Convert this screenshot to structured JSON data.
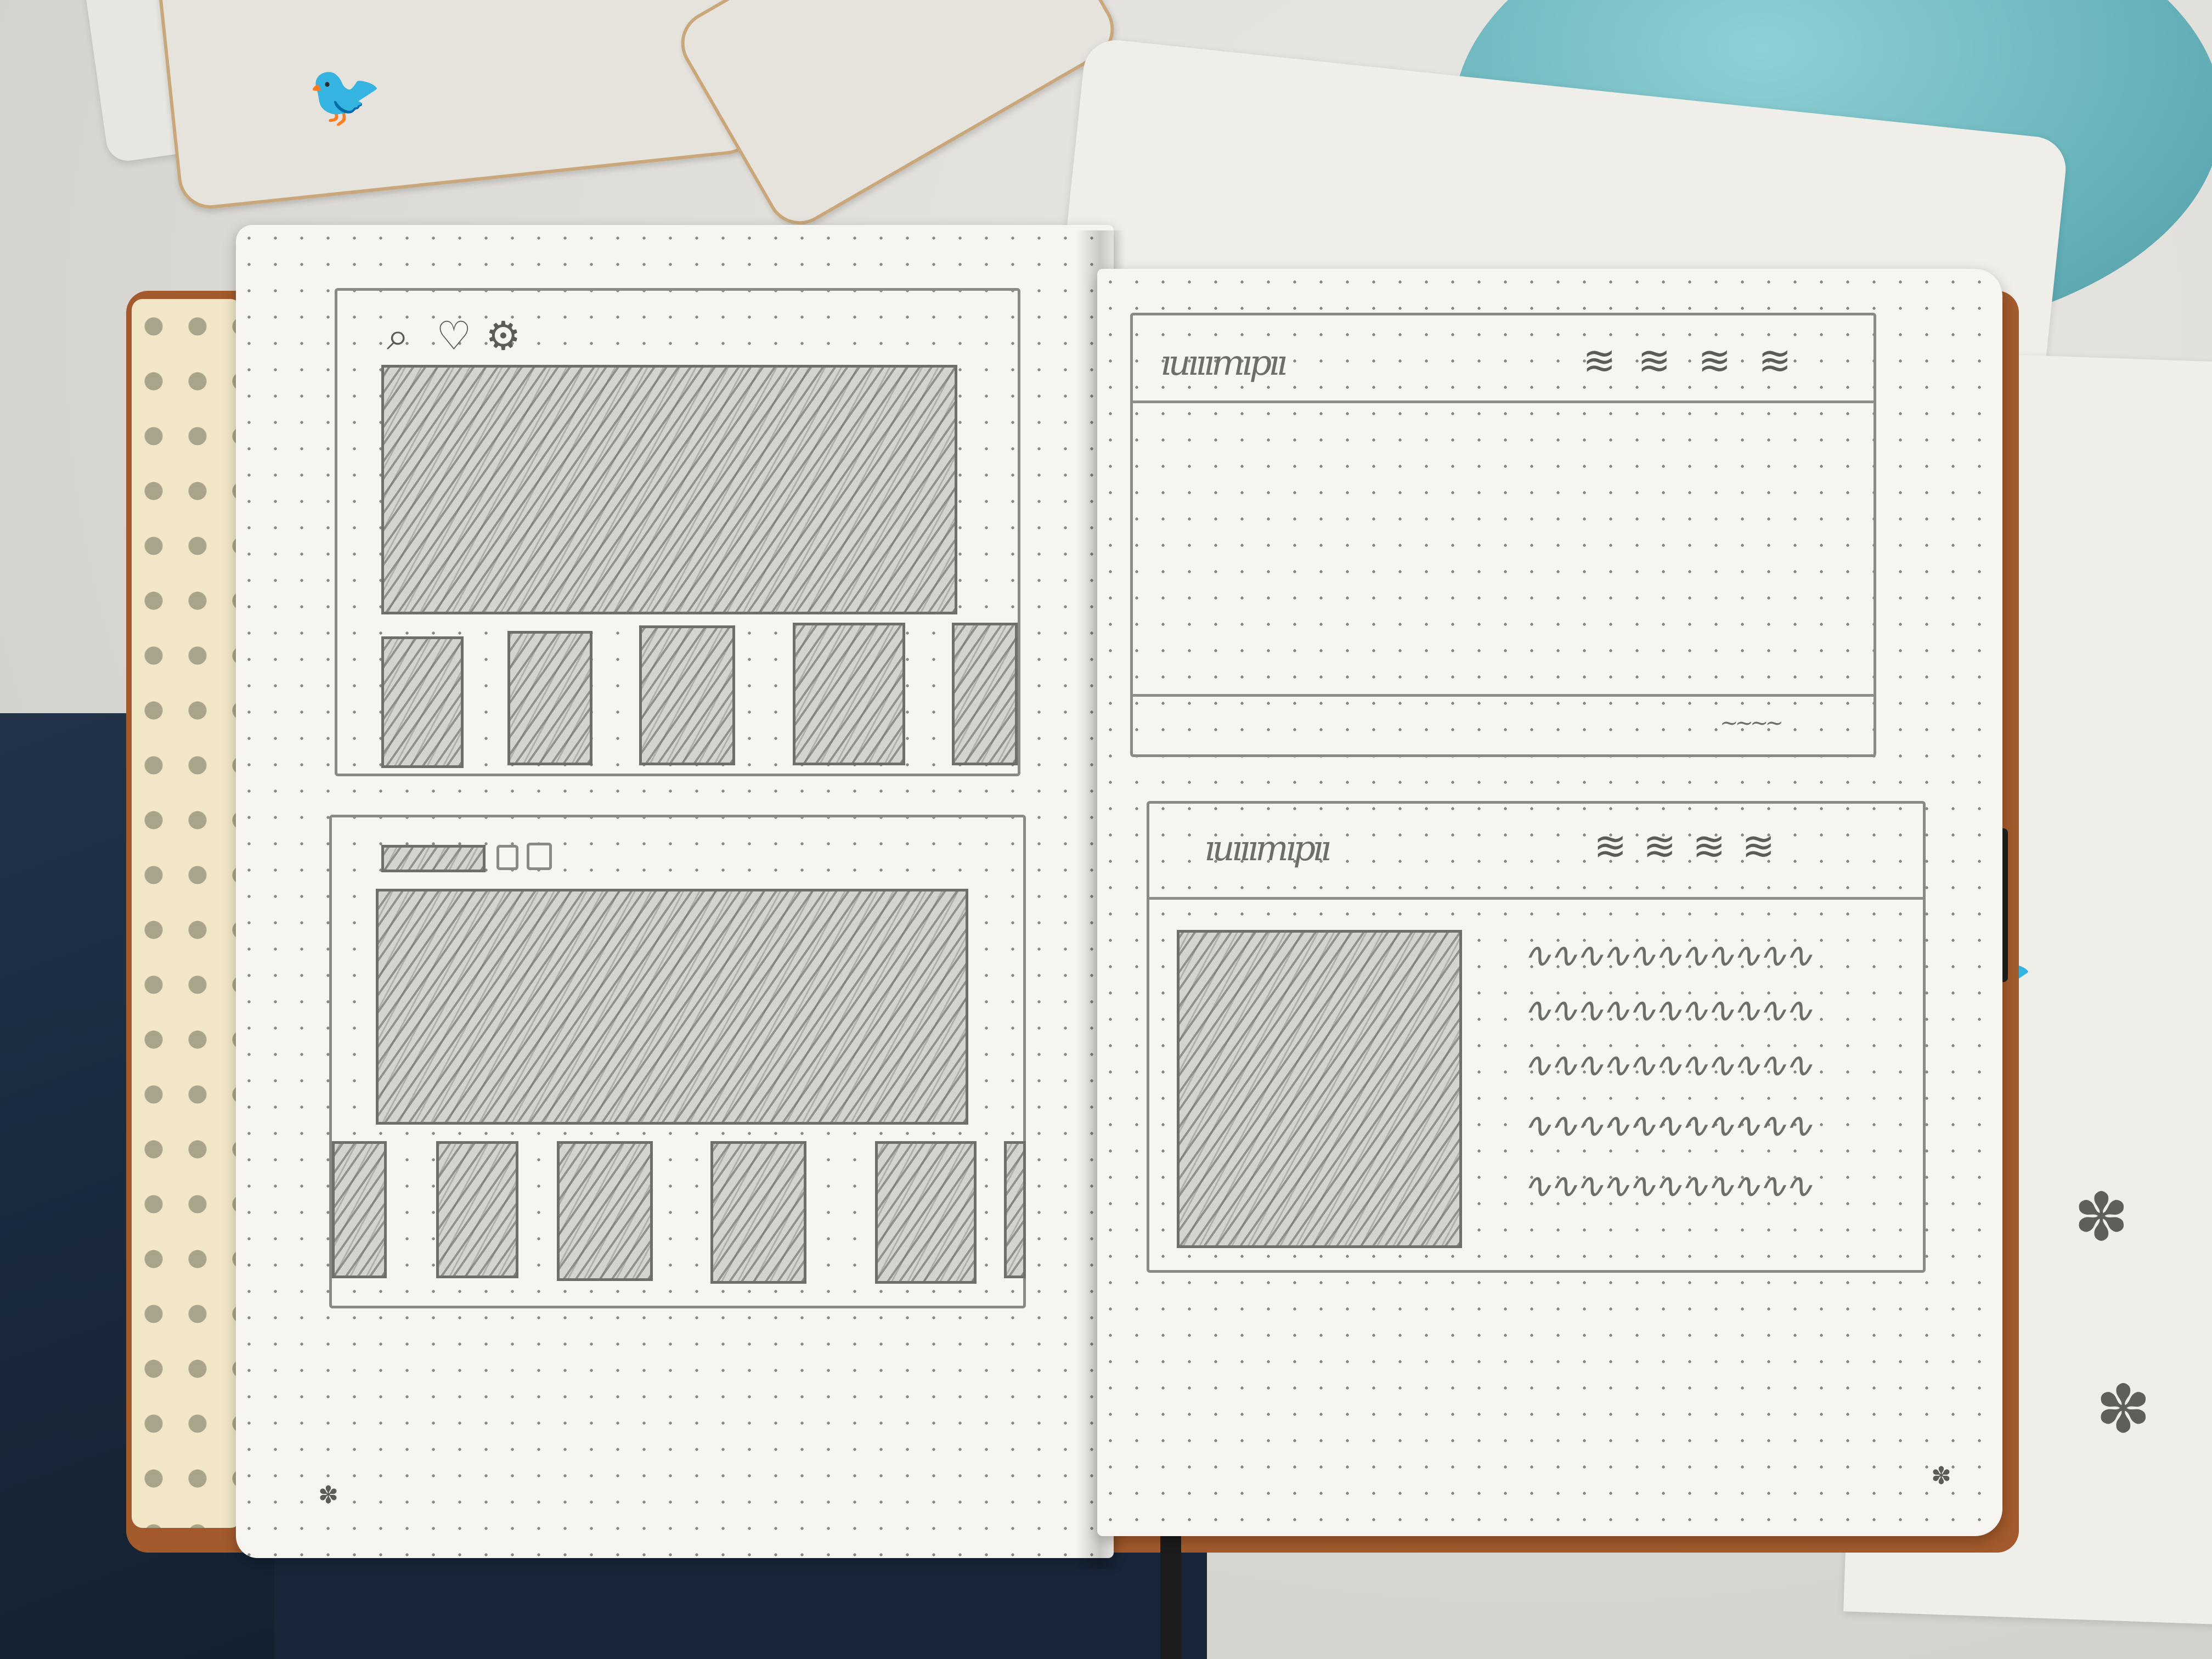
{
  "scene": {
    "description_free": true,
    "colors": {
      "page": "#f6f5f1",
      "pencil": "#6f6e6b",
      "cover": "#a35a2c",
      "jeans": "#1a2a3d",
      "teal_cup": "#67b2bb"
    }
  },
  "left_page": {
    "wireframe_top": {
      "icons": [
        "search-icon",
        "heart-icon",
        "gear-icon"
      ],
      "thumbnail_count": 5
    },
    "wireframe_bottom": {
      "thumbnail_count": 6
    },
    "page_mark_icon": "flower-icon"
  },
  "right_page": {
    "wireframe_top": {
      "header_icons": 4,
      "footer_scribble": "~~~~"
    },
    "wireframe_bottom": {
      "header_icons": 4,
      "text_lines": 5
    },
    "page_mark_icon": "flower-icon"
  },
  "glyphs": {
    "search": "⌕",
    "heart": "♡",
    "gear": "⚙",
    "flower": "✽",
    "scribble_short": "≋",
    "wave_line": "∿∿∿∿∿∿∿∿∿∿∿",
    "title_scribble": "ıuııımıpıı",
    "bird": "🐦"
  }
}
